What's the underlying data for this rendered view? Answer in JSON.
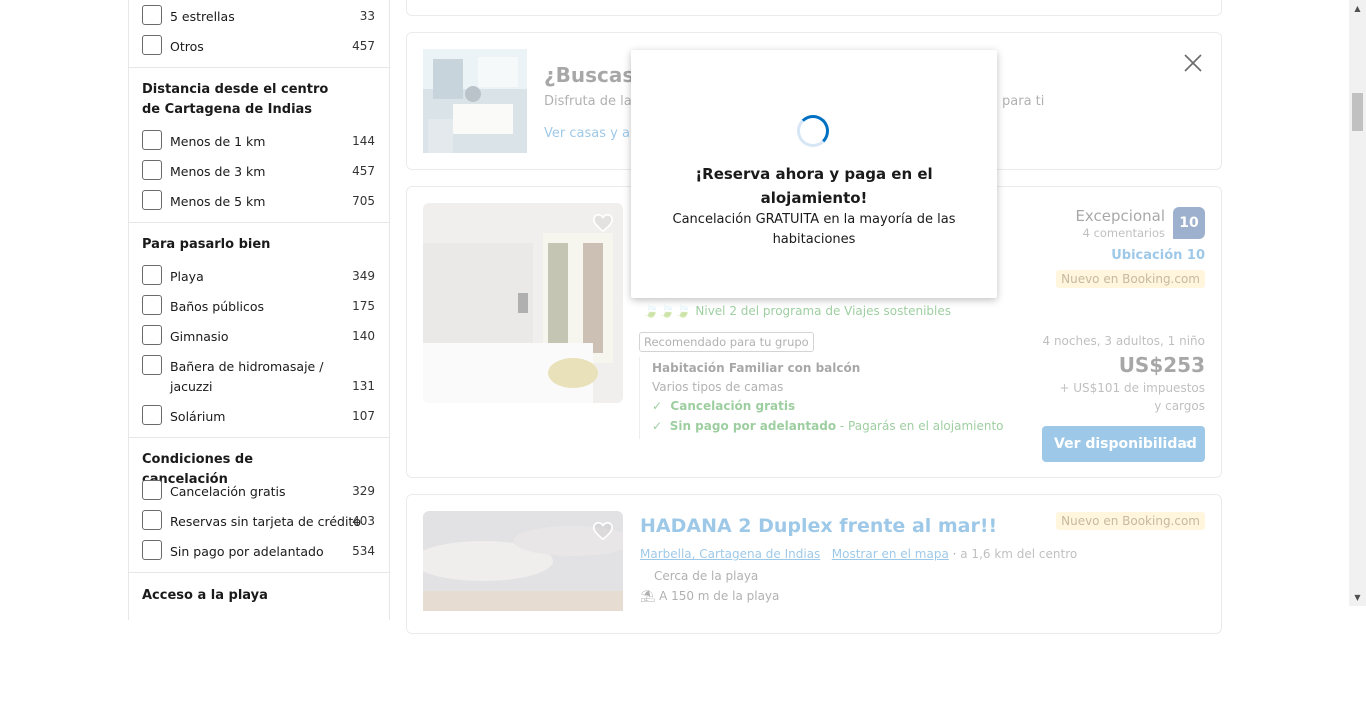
{
  "filters": {
    "stars": [
      {
        "label": "5 estrellas",
        "count": "33"
      },
      {
        "label": "Otros",
        "count": "457"
      }
    ],
    "distance": {
      "title": "Distancia desde el centro de Cartagena de Indias",
      "items": [
        {
          "label": "Menos de 1 km",
          "count": "144"
        },
        {
          "label": "Menos de 3 km",
          "count": "457"
        },
        {
          "label": "Menos de 5 km",
          "count": "705"
        }
      ]
    },
    "fun": {
      "title": "Para pasarlo bien",
      "items": [
        {
          "label": "Playa",
          "count": "349"
        },
        {
          "label": "Baños públicos",
          "count": "175"
        },
        {
          "label": "Gimnasio",
          "count": "140"
        },
        {
          "label": "Bañera de hidromasaje / jacuzzi",
          "count": "131"
        },
        {
          "label": "Solárium",
          "count": "107"
        }
      ]
    },
    "cancel": {
      "title": "Condiciones de cancelación",
      "items": [
        {
          "label": "Cancelación gratis",
          "count": "329"
        },
        {
          "label": "Reservas sin tarjeta de crédito",
          "count": "403"
        },
        {
          "label": "Sin pago por adelantado",
          "count": "534"
        }
      ]
    },
    "beach": {
      "title": "Acceso a la playa"
    }
  },
  "promo": {
    "title": "¿Buscas tu",
    "desc_start": "Disfruta de la p",
    "desc_end": "para ti",
    "link": "Ver casas y apa"
  },
  "listing1": {
    "rating_word": "Excepcional",
    "reviews": "4 comentarios",
    "score": "10",
    "location_score": "Ubicación 10",
    "new_badge": "Nuevo en Booking.com",
    "sustainable": "Nivel 2 del programa de Viajes sostenibles",
    "group_tag": "Recomendado para tu grupo",
    "room_name": "Habitación Familiar con balcón",
    "beds": "Varios tipos de camas",
    "free_cancel": "Cancelación gratis",
    "no_prepay": "Sin pago por adelantado",
    "no_prepay_note": "- Pagarás en el alojamiento",
    "stay": "4 noches, 3 adultos, 1 niño",
    "price": "US$253",
    "taxes": "+ US$101 de impuestos y cargos",
    "button": "Ver disponibilidad"
  },
  "listing2": {
    "title": "HADANA 2 Duplex frente al mar!!",
    "new_badge": "Nuevo en Booking.com",
    "area": "Marbella, Cartagena de Indias",
    "map_link": "Mostrar en el mapa",
    "distance": "a 1,6 km del centro",
    "near": "Cerca de la playa",
    "beach_dist": "A 150 m de la playa"
  },
  "modal": {
    "title": "¡Reserva ahora y paga en el alojamiento!",
    "subtitle": "Cancelación GRATUITA en la mayoría de las habitaciones"
  },
  "colors": {
    "accent": "#0071c2",
    "green": "#008009",
    "badge": "#ffe8a8"
  }
}
